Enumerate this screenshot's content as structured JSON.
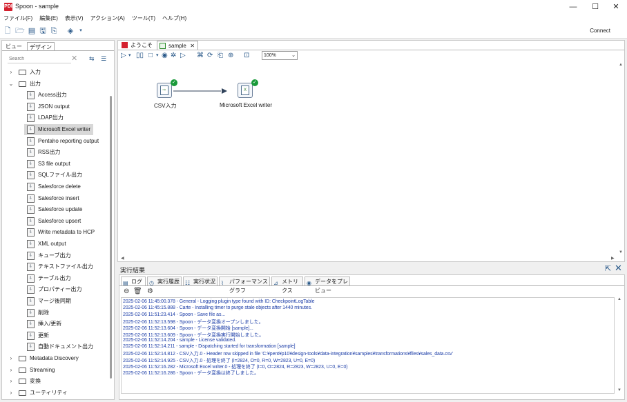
{
  "window": {
    "title": "Spoon - sample",
    "app_icon": "pdi-logo-icon",
    "minimize": "—",
    "maximize": "☐",
    "close": "✕",
    "app_logo_text": "PDI"
  },
  "menu": [
    "ファイル(F)",
    "編集(E)",
    "表示(V)",
    "アクション(A)",
    "ツール(T)",
    "ヘルプ(H)"
  ],
  "toolbar": {
    "connect_label": "Connect"
  },
  "left_panel": {
    "tabs": [
      "ビュー",
      "デザイン"
    ],
    "search_placeholder": "Search",
    "tree": [
      {
        "type": "folder",
        "label": "入力",
        "expanded": false
      },
      {
        "type": "folder",
        "label": "出力",
        "expanded": true
      },
      {
        "type": "step",
        "label": "Access出力"
      },
      {
        "type": "step",
        "label": "JSON output"
      },
      {
        "type": "step",
        "label": "LDAP出力"
      },
      {
        "type": "step",
        "label": "Microsoft Excel writer",
        "selected": true
      },
      {
        "type": "step",
        "label": "Pentaho reporting output"
      },
      {
        "type": "step",
        "label": "RSS出力"
      },
      {
        "type": "step",
        "label": "S3 file output"
      },
      {
        "type": "step",
        "label": "SQLファイル出力"
      },
      {
        "type": "step",
        "label": "Salesforce delete"
      },
      {
        "type": "step",
        "label": "Salesforce insert"
      },
      {
        "type": "step",
        "label": "Salesforce update"
      },
      {
        "type": "step",
        "label": "Salesforce upsert"
      },
      {
        "type": "step",
        "label": "Write metadata to HCP"
      },
      {
        "type": "step",
        "label": "XML output"
      },
      {
        "type": "step",
        "label": "キューブ出力"
      },
      {
        "type": "step",
        "label": "テキストファイル出力"
      },
      {
        "type": "step",
        "label": "テーブル出力"
      },
      {
        "type": "step",
        "label": "プロパティー出力"
      },
      {
        "type": "step",
        "label": "マージ後同期"
      },
      {
        "type": "step",
        "label": "削除"
      },
      {
        "type": "step",
        "label": "挿入/更新"
      },
      {
        "type": "step",
        "label": "更新"
      },
      {
        "type": "step",
        "label": "自動ドキュメント出力"
      },
      {
        "type": "folder",
        "label": "Metadata Discovery",
        "expanded": false
      },
      {
        "type": "folder",
        "label": "Streaming",
        "expanded": false
      },
      {
        "type": "folder",
        "label": "変換",
        "expanded": false
      },
      {
        "type": "folder",
        "label": "ユーティリティ",
        "expanded": false
      }
    ]
  },
  "editor": {
    "tabs": [
      {
        "label": "ようこそ",
        "icon": "pdi-logo-icon"
      },
      {
        "label": "sample",
        "icon": "transformation-icon",
        "closable": true
      }
    ],
    "zoom": "100%",
    "steps": [
      {
        "label": "CSV入力",
        "icon": "csv-input-icon",
        "status": "ok"
      },
      {
        "label": "Microsoft Excel writer",
        "icon": "excel-writer-icon",
        "status": "ok"
      }
    ]
  },
  "results": {
    "title": "実行結果",
    "tabs": [
      "ログ",
      "実行履歴",
      "実行状況",
      "パフォーマンスグラフ",
      "メトリクス",
      "データをプレビュー"
    ],
    "log_lines": [
      "2025-02-06 11:45:00.378 - General - Logging plugin type found with ID: CheckpointLogTable",
      "2025-02-06 11:45:15.888 - Carte - Installing timer to purge stale objects after 1440 minutes.",
      "2025-02-06 11:51:23.414 - Spoon - Save file as...",
      "2025-02-06 11:52:13.598 - Spoon - データ変換オープンしました。",
      "2025-02-06 11:52:13.604 - Spoon - データ変換開始 [sample]...",
      "2025-02-06 11:52:13.609 - Spoon - データ変換実行開始しました。",
      "2025-02-06 11:52:14.204 - sample - License validated.",
      "2025-02-06 11:52:14.211 - sample - Dispatching started for transformation [sample]",
      "2025-02-06 11:52:14.812 - CSV入力.0 - Header row skipped in file 'C:¥pent¥p10¥design-tools¥data-integration¥samples¥transformations¥files¥sales_data.csv'",
      "2025-02-06 11:52:14.925 - CSV入力.0 - 処理を終了 (I=2824, O=0, R=0, W=2823, U=0, E=0)",
      "2025-02-06 11:52:16.282 - Microsoft Excel writer.0 - 処理を終了 (I=0, O=2824, R=2823, W=2823, U=0, E=0)",
      "2025-02-06 11:52:16.286 - Spoon - データ変換は終了しました。"
    ]
  }
}
